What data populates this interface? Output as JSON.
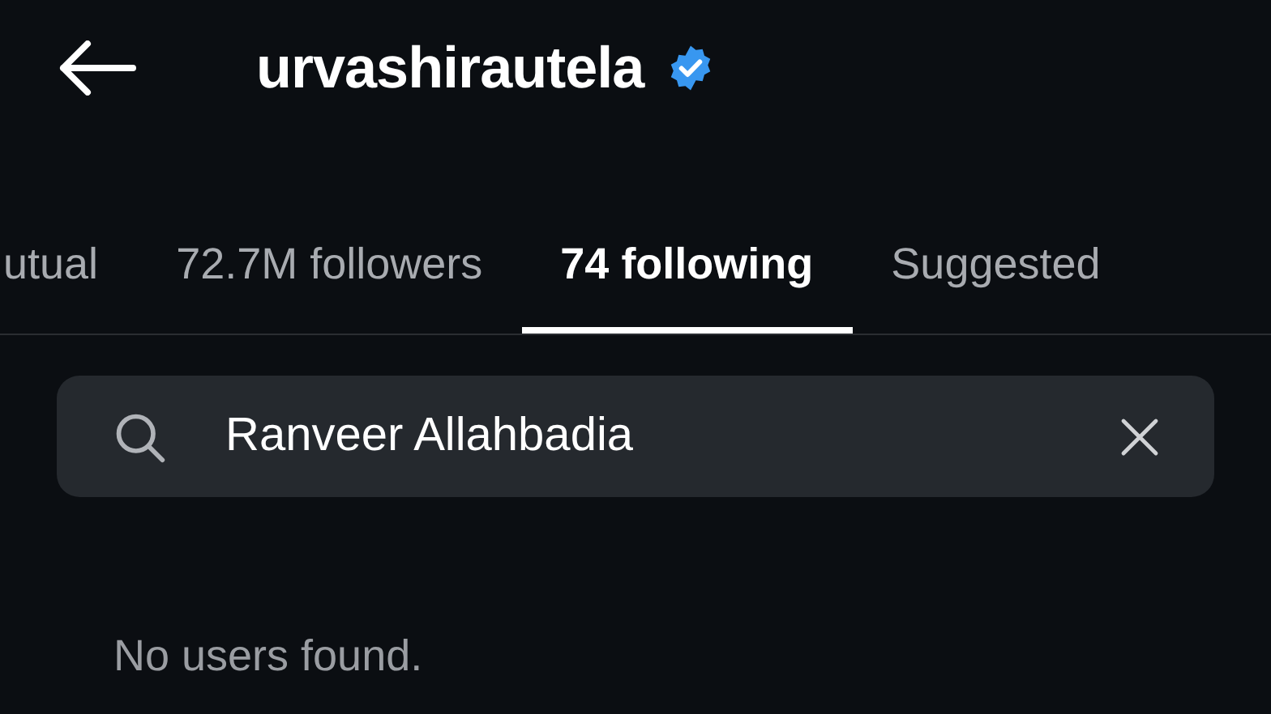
{
  "header": {
    "username": "urvashirautela",
    "verified": true
  },
  "tabs": [
    {
      "label": "utual",
      "selected": false
    },
    {
      "label": "72.7M followers",
      "selected": false
    },
    {
      "label": "74 following",
      "selected": true
    },
    {
      "label": "Suggested",
      "selected": false
    }
  ],
  "search": {
    "value": "Ranveer Allahbadia"
  },
  "empty_message": "No users found."
}
